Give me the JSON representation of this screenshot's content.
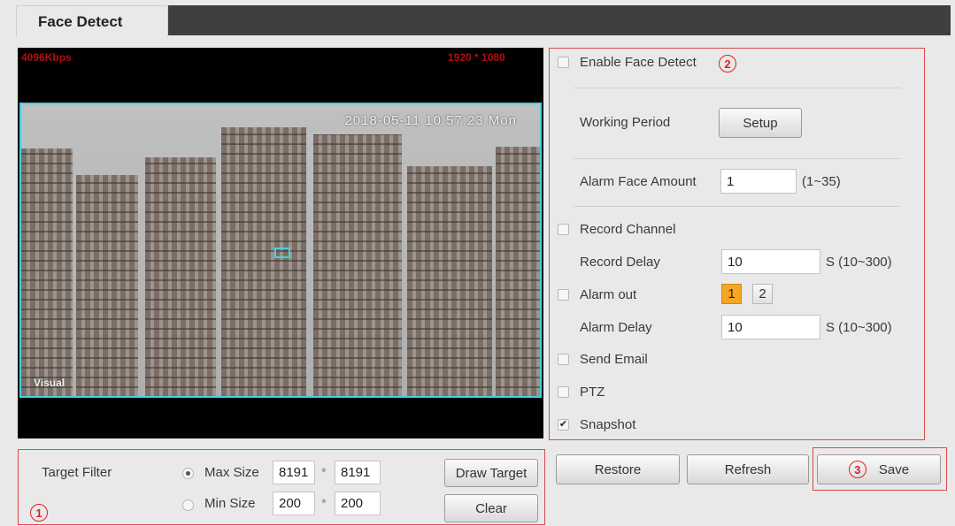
{
  "tab": {
    "label": "Face Detect"
  },
  "video": {
    "bitrate": "4096Kbps",
    "resolution": "1920 * 1080",
    "timestamp": "2018-05-11 10:57:23 Mon",
    "channel_name": "Visual"
  },
  "settings": {
    "marker": "2",
    "enable_face_detect": {
      "label": "Enable Face Detect",
      "checked": false
    },
    "working_period": {
      "label": "Working Period",
      "button": "Setup"
    },
    "alarm_face_amount": {
      "label": "Alarm Face Amount",
      "value": "1",
      "range": "(1~35)"
    },
    "record_channel": {
      "label": "Record Channel",
      "checked": false
    },
    "record_delay": {
      "label": "Record Delay",
      "value": "10",
      "range": "S (10~300)"
    },
    "alarm_out": {
      "label": "Alarm out",
      "checked": false,
      "channels": [
        "1",
        "2"
      ],
      "active_channel": "1"
    },
    "alarm_delay": {
      "label": "Alarm Delay",
      "value": "10",
      "range": "S (10~300)"
    },
    "send_email": {
      "label": "Send Email",
      "checked": false
    },
    "ptz": {
      "label": "PTZ",
      "checked": false
    },
    "snapshot": {
      "label": "Snapshot",
      "checked": true,
      "mark": "✔"
    }
  },
  "target_filter": {
    "marker": "1",
    "label": "Target Filter",
    "max": {
      "label": "Max Size",
      "selected": true,
      "w": "8191",
      "h": "8191"
    },
    "min": {
      "label": "Min Size",
      "selected": false,
      "w": "200",
      "h": "200"
    },
    "separator": "*",
    "draw_button": "Draw Target",
    "clear_button": "Clear"
  },
  "actions": {
    "restore": "Restore",
    "refresh": "Refresh",
    "save": "Save",
    "save_marker": "3"
  },
  "colors": {
    "accent_red": "#d22222",
    "detect_box": "#43d1e0",
    "alarm_active": "#f5a623"
  }
}
